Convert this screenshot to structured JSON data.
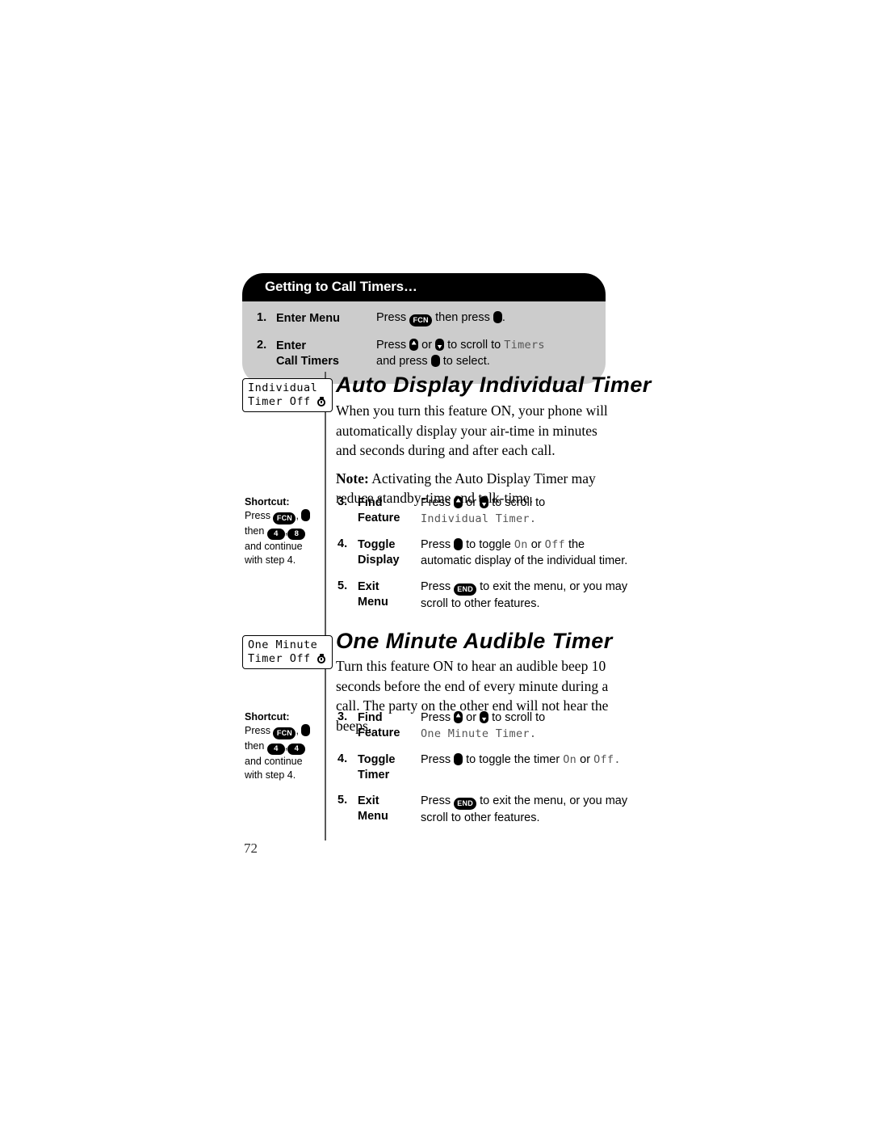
{
  "page": {
    "number": "72"
  },
  "callout": {
    "title": "Getting to Call Timers…",
    "steps": [
      {
        "number": "1.",
        "label": "Enter Menu",
        "text_before": "Press",
        "text_middle": "then press",
        "text_after": ".",
        "keys": [
          "FCN",
          "select"
        ]
      },
      {
        "number": "2.",
        "label_line1": "Enter",
        "label_line2": "Call Timers",
        "line1_before": "Press",
        "line1_middle": "or",
        "line1_after": "to scroll to",
        "line1_mono": "Timers",
        "line2_before": "and press",
        "line2_after": "to select."
      }
    ]
  },
  "features": [
    {
      "id": "auto-display-individual-timer",
      "title": "Auto Display Individual Timer",
      "lcd": {
        "line1": "Individual",
        "line2": "Timer Off",
        "icon": "stopwatch-icon"
      },
      "paragraphs": [
        "When you turn this feature ON, your phone will automatically display your air-time in minutes and seconds during and after each call."
      ],
      "note_label": "Note:",
      "note_text": "Activating the Auto Display Timer may reduce standby-time and talk-time.",
      "shortcut": {
        "title": "Shortcut:",
        "press_label": "Press",
        "fcn_key": "FCN",
        "then_label": "then",
        "key1": "4",
        "key2": "8",
        "tail_line1": "and continue",
        "tail_line2": "with step 4."
      },
      "steps": [
        {
          "number": "3.",
          "label_line1": "Find",
          "label_line2": "Feature",
          "text_before": "Press",
          "text_middle": "or",
          "text_after": "to scroll to",
          "mono": "Individual Timer."
        },
        {
          "number": "4.",
          "label_line1": "Toggle",
          "label_line2": "Display",
          "text_before": "Press",
          "text_mid1": "to toggle",
          "mono_on": "On",
          "text_mid2": "or",
          "mono_off": "Off",
          "text_after": "the automatic display of the individual timer."
        },
        {
          "number": "5.",
          "label_line1": "Exit",
          "label_line2": "Menu",
          "text_before": "Press",
          "text_after": "to exit the menu, or you may scroll to other features."
        }
      ]
    },
    {
      "id": "one-minute-audible-timer",
      "title": "One Minute Audible Timer",
      "lcd": {
        "line1": "One Minute",
        "line2": "Timer Off",
        "icon": "stopwatch-icon"
      },
      "paragraphs": [
        "Turn this feature ON to hear an audible beep 10 seconds before the end of every minute during a call. The party on the other end will not hear the beeps."
      ],
      "shortcut": {
        "title": "Shortcut:",
        "press_label": "Press",
        "fcn_key": "FCN",
        "then_label": "then",
        "key1": "4",
        "key2": "4",
        "tail_line1": "and continue",
        "tail_line2": "with step 4."
      },
      "steps": [
        {
          "number": "3.",
          "label_line1": "Find",
          "label_line2": "Feature",
          "text_before": "Press",
          "text_middle": "or",
          "text_after": "to scroll to",
          "mono": "One Minute Timer."
        },
        {
          "number": "4.",
          "label_line1": "Toggle",
          "label_line2": "Timer",
          "text_before": "Press",
          "text_mid1": "to toggle the timer",
          "mono_on": "On",
          "text_mid2": "or",
          "mono_off": "Off.",
          "text_after": ""
        },
        {
          "number": "5.",
          "label_line1": "Exit",
          "label_line2": "Menu",
          "text_before": "Press",
          "text_after": "to exit the menu, or you may scroll to other features."
        }
      ]
    }
  ],
  "keys": {
    "fcn": "FCN",
    "end": "END"
  }
}
